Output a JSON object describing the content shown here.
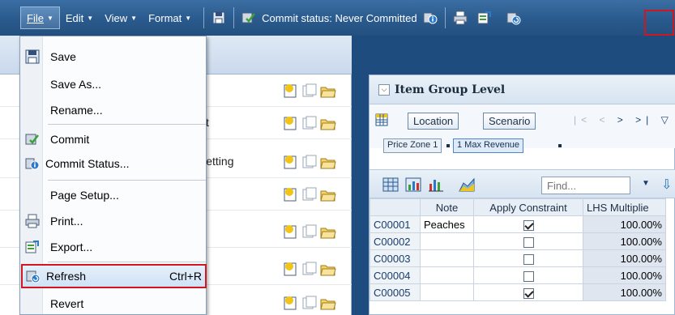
{
  "toolbar": {
    "menus": [
      {
        "label": "File"
      },
      {
        "label": "Edit"
      },
      {
        "label": "View"
      },
      {
        "label": "Format"
      }
    ],
    "commit_status": "Commit status: Never Committed"
  },
  "file_menu": {
    "items": [
      {
        "label": "Save",
        "icon": "save-icon"
      },
      {
        "label": "Save As...",
        "icon": ""
      },
      {
        "label": "Rename...",
        "icon": ""
      },
      {
        "label": "Commit",
        "icon": "commit-icon"
      },
      {
        "label": "Commit Status...",
        "icon": "commit-status-icon"
      },
      {
        "label": "Page Setup...",
        "icon": ""
      },
      {
        "label": "Print...",
        "icon": "print-icon"
      },
      {
        "label": "Export...",
        "icon": "export-icon"
      },
      {
        "label": "Refresh",
        "icon": "refresh-icon",
        "shortcut": "Ctrl+R"
      },
      {
        "label": "Revert",
        "icon": ""
      }
    ]
  },
  "left_panel": {
    "row_texts": [
      "t",
      "y Setting"
    ]
  },
  "right_panel": {
    "title": "Item Group Level",
    "dimensions": [
      "Location",
      "Scenario"
    ],
    "members": [
      "Price Zone 1",
      "1 Max Revenue"
    ],
    "find_placeholder": "Find...",
    "columns": [
      "",
      "Note",
      "Apply Constraint",
      "LHS Multiplie"
    ],
    "rows": [
      {
        "id": "C00001",
        "note": "Peaches",
        "apply": true,
        "lhs": "100.00%"
      },
      {
        "id": "C00002",
        "note": "",
        "apply": false,
        "lhs": "100.00%"
      },
      {
        "id": "C00003",
        "note": "",
        "apply": false,
        "lhs": "100.00%"
      },
      {
        "id": "C00004",
        "note": "",
        "apply": false,
        "lhs": "100.00%"
      },
      {
        "id": "C00005",
        "note": "",
        "apply": true,
        "lhs": "100.00%"
      }
    ]
  },
  "colors": {
    "toolbar_blue": "#2a5a8d",
    "highlight_red": "#d0161e",
    "menu_hover": "#cfe2f6"
  }
}
